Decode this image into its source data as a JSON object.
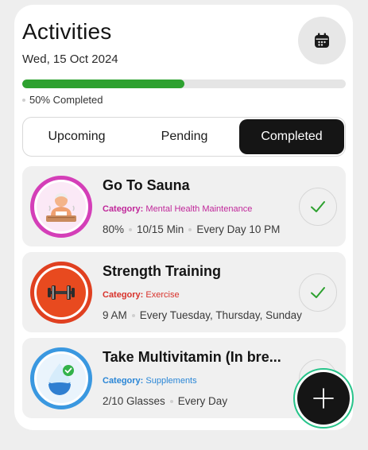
{
  "header": {
    "title": "Activities",
    "date": "Wed, 15 Oct 2024",
    "calendar_icon": "calendar-icon"
  },
  "progress": {
    "fraction": 0.5,
    "label": "50% Completed",
    "color": "#2da12f"
  },
  "tabs": [
    {
      "label": "Upcoming",
      "selected": false
    },
    {
      "label": "Pending",
      "selected": false
    },
    {
      "label": "Completed",
      "selected": true
    }
  ],
  "activities": [
    {
      "title": "Go To Sauna",
      "category_key": "Category:",
      "category": "Mental Health Maintenance",
      "category_color": "#c0279a",
      "ring_color": "#d43fb8",
      "icon": "sauna-person-icon",
      "meta": [
        "80%",
        "10/15 Min",
        "Every Day 10 PM"
      ],
      "done": true
    },
    {
      "title": "Strength Training",
      "category_key": "Category:",
      "category": "Exercise",
      "category_color": "#d8322b",
      "ring_color": "#e04020",
      "icon": "dumbbell-icon",
      "meta": [
        "9 AM",
        "Every Tuesday, Thursday, Sunday"
      ],
      "done": true
    },
    {
      "title": "Take Multivitamin (In bre...",
      "category_key": "Category:",
      "category": "Supplements",
      "category_color": "#2a86d6",
      "ring_color": "#3a98e0",
      "icon": "water-drop-check-icon",
      "meta": [
        "2/10 Glasses",
        "Every Day"
      ],
      "done": true
    }
  ],
  "fab": {
    "icon": "plus-icon",
    "accent": "#27c48a"
  }
}
